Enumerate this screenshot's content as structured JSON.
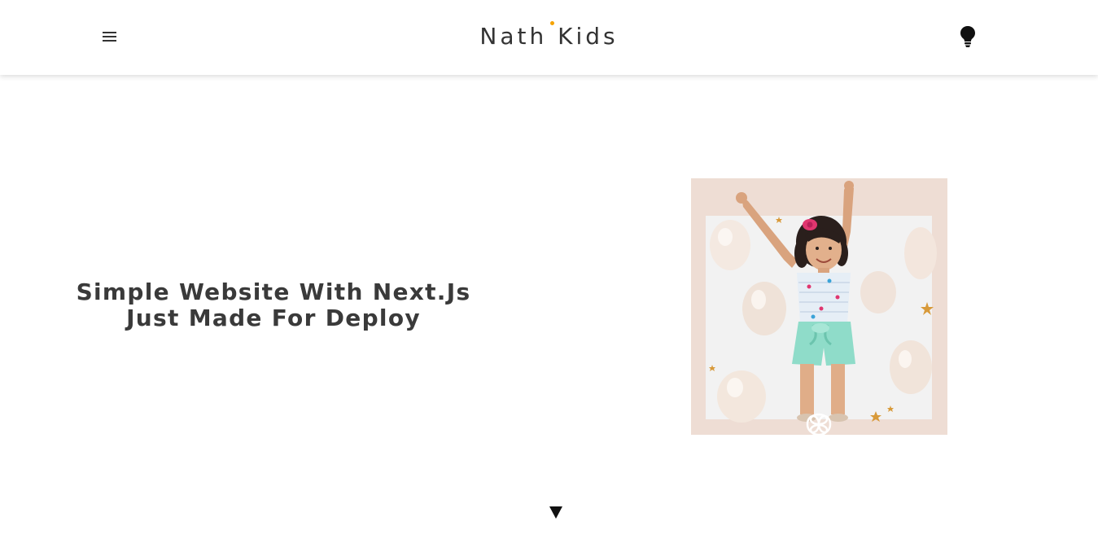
{
  "header": {
    "brand": {
      "word1": "Nath",
      "word2": "Kids",
      "accent_color": "#f5a300"
    },
    "menu_icon": "hamburger-menu-icon",
    "theme_toggle_icon": "lightbulb-icon"
  },
  "hero": {
    "title_line1": "Simple Website With Next.Js",
    "title_line2": "Just Made For Deploy",
    "image_icon": "girl-with-balloons-photo",
    "image_colors": {
      "frame": "#eeddd4",
      "backdrop": "#f2f2f2",
      "shirt": "#e6eef6",
      "shorts": "#8fdcc9"
    }
  },
  "scroll_indicator_icon": "triangle-down-icon"
}
